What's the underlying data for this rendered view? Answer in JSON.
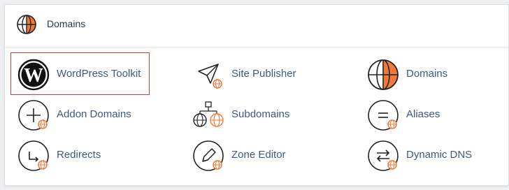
{
  "header": {
    "title": "Domains",
    "icon": "globe-icon"
  },
  "items": [
    {
      "label": "WordPress Toolkit",
      "icon": "wordpress-icon"
    },
    {
      "label": "Site Publisher",
      "icon": "site-publisher-icon"
    },
    {
      "label": "Domains",
      "icon": "globe-icon"
    },
    {
      "label": "Addon Domains",
      "icon": "addon-domains-icon"
    },
    {
      "label": "Subdomains",
      "icon": "subdomains-icon"
    },
    {
      "label": "Aliases",
      "icon": "aliases-icon"
    },
    {
      "label": "Redirects",
      "icon": "redirects-icon"
    },
    {
      "label": "Zone Editor",
      "icon": "zone-editor-icon"
    },
    {
      "label": "Dynamic DNS",
      "icon": "dynamic-dns-icon"
    }
  ],
  "colors": {
    "accent": "#f07a3a",
    "link": "#3d5a80",
    "highlight_border": "#d23c3c",
    "icon_stroke": "#222222"
  }
}
